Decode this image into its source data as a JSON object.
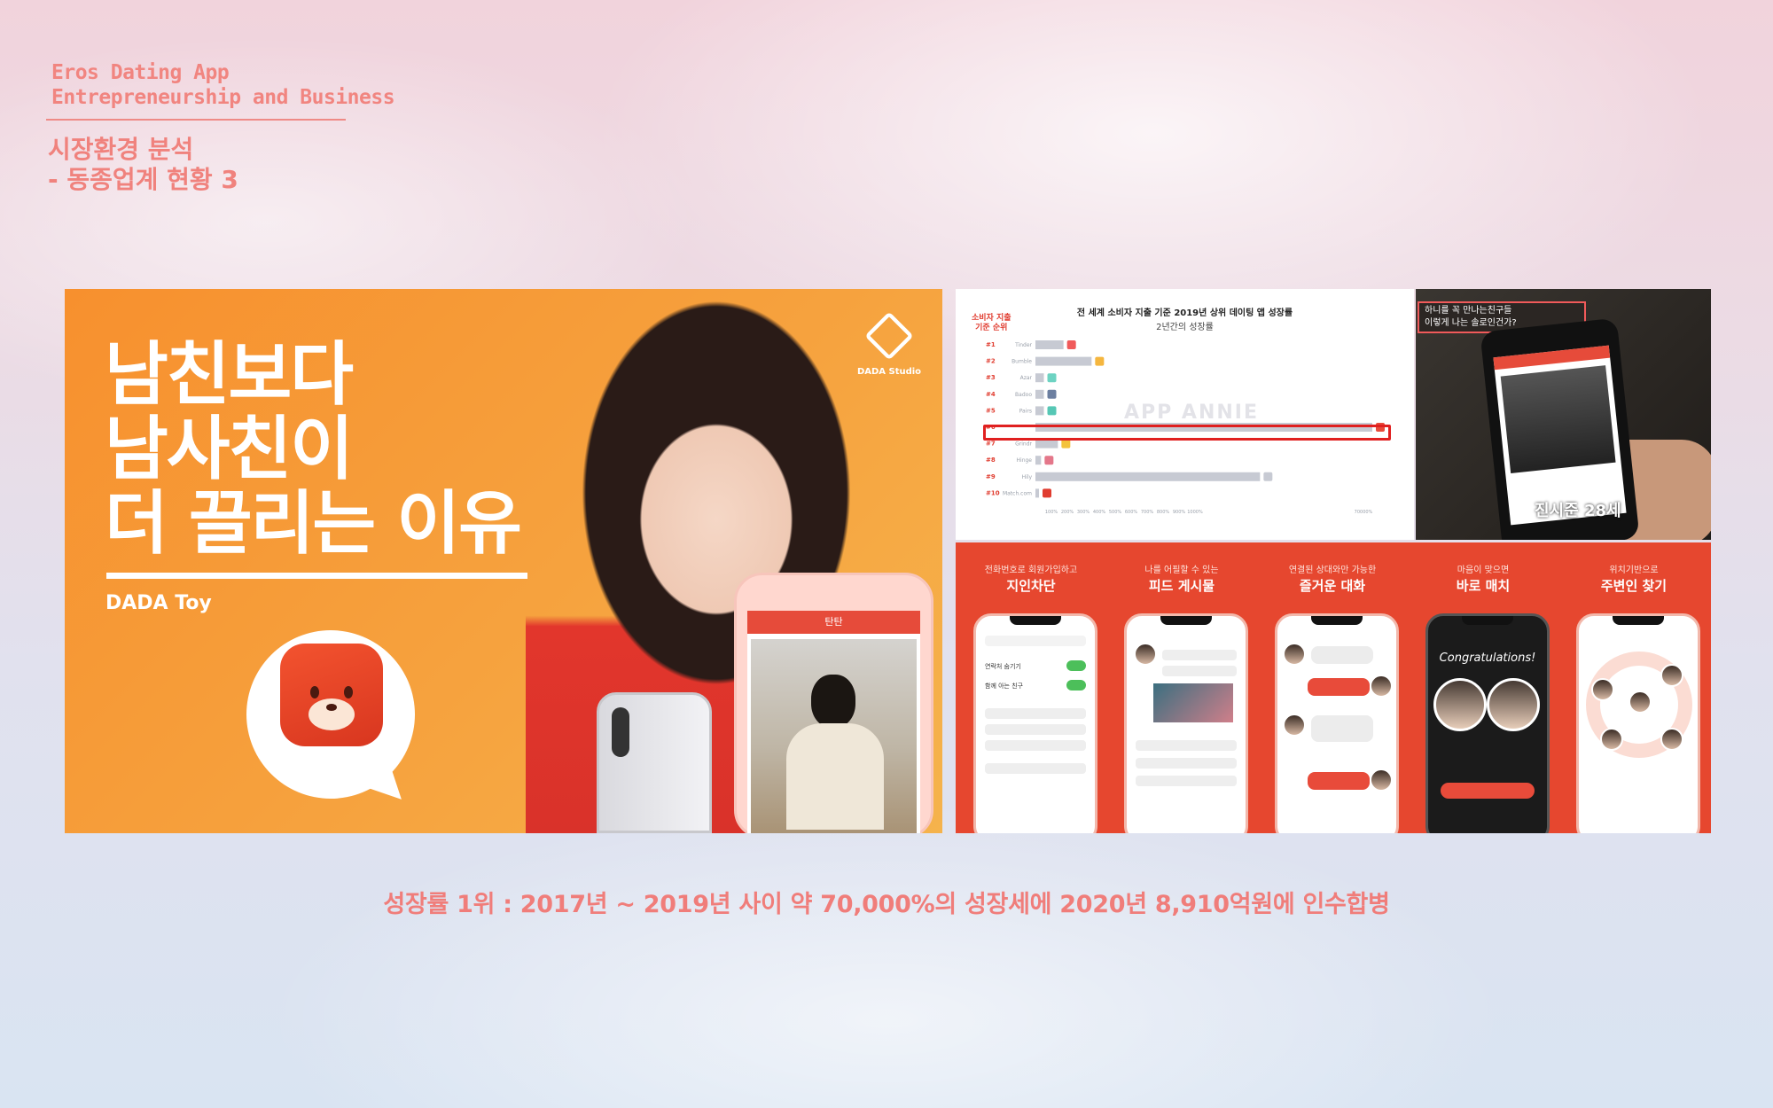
{
  "header": {
    "app_title_line1": "Eros Dating App",
    "app_title_line2": "Entrepreneurship and Business",
    "section_line1": "시장환경 분석",
    "section_line2": "- 동종업계 현황 3"
  },
  "thumbnail": {
    "headline_line1": "남친보다",
    "headline_line2": "남사친이",
    "headline_line3": "더 끌리는 이유",
    "brand": "DADA Toy",
    "studio": "DADA Studio",
    "mock_app_title": "탄탄"
  },
  "growth_chart": {
    "title": "전 세계 소비자 지출 기준 2019년 상위 데이팅 앱 성장률",
    "subtitle": "2년간의 성장률",
    "legend": [
      "소비자 지출",
      "기준 순위"
    ],
    "watermark": "APP ANNIE"
  },
  "chart_data": {
    "type": "bar",
    "title": "전 세계 소비자 지출 기준 2019년 상위 데이팅 앱 성장률",
    "subtitle": "2년간의 성장률",
    "categories": [
      "#1",
      "#2",
      "#3",
      "#4",
      "#5",
      "#6",
      "#7",
      "#8",
      "#9",
      "#10"
    ],
    "apps": [
      "Tinder",
      "Bumble",
      "Azar",
      "Badoo",
      "Pairs",
      "",
      "Grindr",
      "Hinge",
      "Hily",
      "Match.com"
    ],
    "values": [
      10,
      20,
      3,
      3,
      3,
      120,
      8,
      2,
      80,
      1
    ],
    "highlighted_index": 5,
    "xticks": [
      "100%",
      "200%",
      "300%",
      "400%",
      "500%",
      "600%",
      "700%",
      "800%",
      "900%",
      "1000%",
      "70000%"
    ],
    "colors": {
      "bar": "#c7cad3",
      "highlight": "#e02020"
    }
  },
  "tv_clip": {
    "banner_line1": "하니를 꼭 만나는친구들",
    "banner_line2": "이렇게 나는 솔로인건가?",
    "caption": "진시준 28세"
  },
  "features": [
    {
      "small": "전화번호로 회원가입하고",
      "big": "지인차단",
      "rows": [
        "연락처 숨기기",
        "함께 아는 친구"
      ]
    },
    {
      "small": "나를 어필할 수 있는",
      "big": "피드 게시물"
    },
    {
      "small": "연결된 상대와만 가능한",
      "big": "즐거운 대화"
    },
    {
      "small": "마음이 맞으면",
      "big": "바로 매치",
      "congrats": "Congratulations!"
    },
    {
      "small": "위치기반으로",
      "big": "주변인 찾기"
    }
  ],
  "caption": "성장률 1위 : 2017년 ~ 2019년 사이 약 70,000%의 성장세에 2020년 8,910억원에 인수합병"
}
